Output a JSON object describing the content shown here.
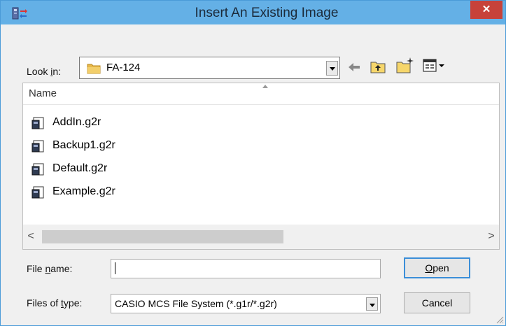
{
  "window": {
    "title": "Insert An Existing Image",
    "close_label": "✕"
  },
  "toolbar": {
    "look_in_label_pre": "Look ",
    "look_in_label_accel": "i",
    "look_in_label_post": "n:",
    "look_in_value": "FA-124",
    "icons": [
      "back-arrow-icon",
      "up-one-level-icon",
      "new-folder-icon",
      "view-menu-icon"
    ]
  },
  "list": {
    "column_header": "Name",
    "files": [
      "AddIn.g2r",
      "Backup1.g2r",
      "Default.g2r",
      "Example.g2r"
    ]
  },
  "scrollbar": {
    "left_arrow": "<",
    "right_arrow": ">"
  },
  "filename": {
    "label_pre": "File ",
    "label_accel": "n",
    "label_post": "ame:",
    "value": ""
  },
  "filetype": {
    "label_pre": "Files of ",
    "label_accel": "t",
    "label_post": "ype:",
    "value": "CASIO MCS File System (*.g1r/*.g2r)"
  },
  "buttons": {
    "open_accel": "O",
    "open_rest": "pen",
    "cancel": "Cancel"
  }
}
